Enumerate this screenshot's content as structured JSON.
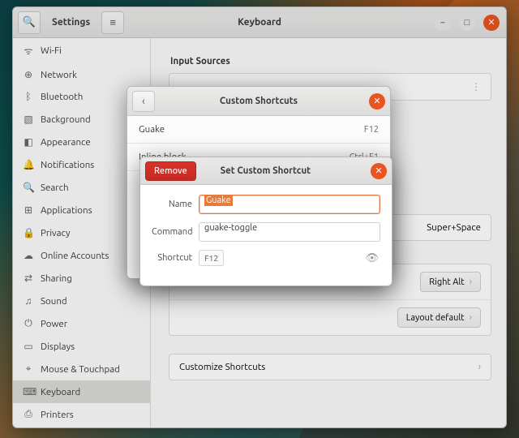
{
  "header": {
    "settings_label": "Settings",
    "page_title": "Keyboard"
  },
  "sidebar": {
    "items": [
      {
        "icon": "wifi",
        "label": "Wi-Fi"
      },
      {
        "icon": "net",
        "label": "Network"
      },
      {
        "icon": "bt",
        "label": "Bluetooth"
      },
      {
        "icon": "bg",
        "label": "Background"
      },
      {
        "icon": "appr",
        "label": "Appearance"
      },
      {
        "icon": "notif",
        "label": "Notifications"
      },
      {
        "icon": "search",
        "label": "Search"
      },
      {
        "icon": "apps",
        "label": "Applications",
        "chev": true
      },
      {
        "icon": "priv",
        "label": "Privacy",
        "chev": true
      },
      {
        "icon": "cloud",
        "label": "Online Accounts"
      },
      {
        "icon": "share",
        "label": "Sharing"
      },
      {
        "icon": "sound",
        "label": "Sound"
      },
      {
        "icon": "power",
        "label": "Power"
      },
      {
        "icon": "disp",
        "label": "Displays"
      },
      {
        "icon": "mouse",
        "label": "Mouse & Touchpad"
      },
      {
        "icon": "kbd",
        "label": "Keyboard",
        "active": true
      },
      {
        "icon": "prn",
        "label": "Printers"
      }
    ]
  },
  "content": {
    "input_sources_label": "Input Sources",
    "switch_shortcut": "Super+Space",
    "compose_label": "Right Alt",
    "layout_default": "Layout default",
    "customize_shortcuts": "Customize Shortcuts"
  },
  "custom_shortcuts_dialog": {
    "title": "Custom Shortcuts",
    "rows": [
      {
        "name": "Guake",
        "key": "F12"
      },
      {
        "name": "Inline block",
        "key": "Ctrl+F1"
      }
    ],
    "add_symbol": "+"
  },
  "set_shortcut_dialog": {
    "remove_label": "Remove",
    "title": "Set Custom Shortcut",
    "name_label": "Name",
    "name_value": "Guake",
    "command_label": "Command",
    "command_value": "guake-toggle",
    "shortcut_label": "Shortcut",
    "shortcut_value": "F12"
  },
  "icons": {
    "wifi": "ᯤ",
    "net": "⊕",
    "bt": "ᛒ",
    "bg": "▧",
    "appr": "◧",
    "notif": "🔔",
    "search": "🔍",
    "apps": "⊞",
    "priv": "🔒",
    "cloud": "☁",
    "share": "⇄",
    "sound": "♫",
    "power": "⏻",
    "disp": "▭",
    "mouse": "⌖",
    "kbd": "⌨",
    "prn": "⎙",
    "menu": "≡",
    "min": "–",
    "max": "□",
    "close": "✕",
    "back": "‹",
    "chev": "›",
    "eye": "👁",
    "more": "⋮"
  }
}
